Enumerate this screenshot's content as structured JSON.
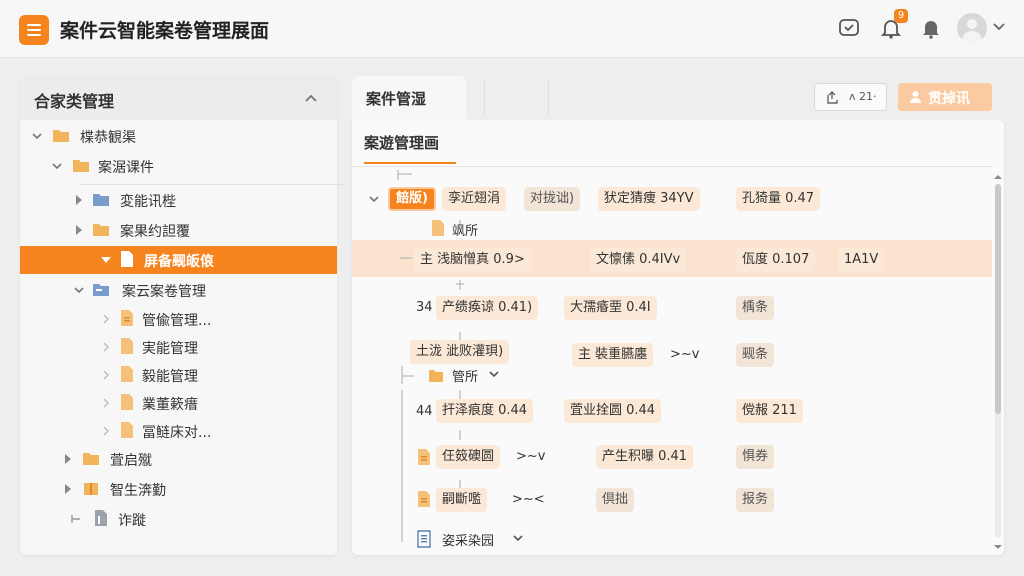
{
  "header": {
    "title": "案件云智能案卷管理展面",
    "notification_count": "9"
  },
  "left_panel": {
    "title": "合家类管理",
    "tree": [
      {
        "label": "楪恭観渠"
      },
      {
        "label": "案涺课件"
      },
      {
        "label": "変能讯梐"
      },
      {
        "label": "案果约詚覆"
      },
      {
        "label": "屏备觋皈偯"
      },
      {
        "label": "案云案卷管理"
      },
      {
        "label": "管偸管理..."
      },
      {
        "label": "実能管理"
      },
      {
        "label": "毅能管理"
      },
      {
        "label": "業董簌瘄"
      },
      {
        "label": "冨鲢床对..."
      },
      {
        "label": "萓启殧"
      },
      {
        "label": "智生渀勤"
      },
      {
        "label": "诈蹝"
      }
    ]
  },
  "main_tab": {
    "label": "案件管湿"
  },
  "toolbar": {
    "export_label": "ʌ 21·",
    "primary_label": "贯掉讯"
  },
  "right_panel": {
    "tab_label": "案遊管理画",
    "rows": {
      "r1_active": "餢版)",
      "r1_c1": "孪近翅涓",
      "r1_c2": "对拢诎)",
      "r1_c3": "犾定猜痩 34YV",
      "r1_c4": "孔猗量 0.47",
      "r2_label": "飒所",
      "r3_c1": "主 浅脑憎真 0.9>",
      "r3_c2": "文懔傃 0.4IVv",
      "r3_c3": "佤度 0.107",
      "r3_c4": "1A1V",
      "r4_prefix": "34",
      "r4_c1": "产缋痪谅 0.41)",
      "r4_c2": "大孺痻垔 0.4I",
      "r4_c3": "楀条",
      "r5_c1": "土泷 泚败灌珼)",
      "r5_c2": "主 裝重臙廛",
      "r5_c2_suffix": ">~v",
      "r5_c3": "觋条",
      "r6_label": "管所",
      "r7_prefix": "44",
      "r7_c1": "扞泽痕度 0.44",
      "r7_c2": "萓业拴圆 0.44",
      "r7_c3": "傥赧 211",
      "r8_c1": "仼笯礇圆",
      "r8_c1_suffix": ">~v",
      "r8_c2": "产生积曝 0.41",
      "r8_c3": "惧券",
      "r9_c1": "嗣斷嚂",
      "r9_c1_suffix": ">~<",
      "r9_c2": "倶拙",
      "r9_c3": "报务",
      "r10_label": "姿采染园"
    }
  },
  "colors": {
    "accent": "#f5841f",
    "chip_bg": "#fbe8d6",
    "highlight_row": "#fbe3cf",
    "primary_disabled": "#fbcaa0"
  },
  "icons": {
    "logo": "list-icon",
    "header_actions": [
      "message-icon",
      "bell-icon",
      "bell-icon",
      "user-avatar",
      "chevron-down-icon"
    ],
    "tree_folder": "folder-icon",
    "tree_file": "file-icon"
  }
}
